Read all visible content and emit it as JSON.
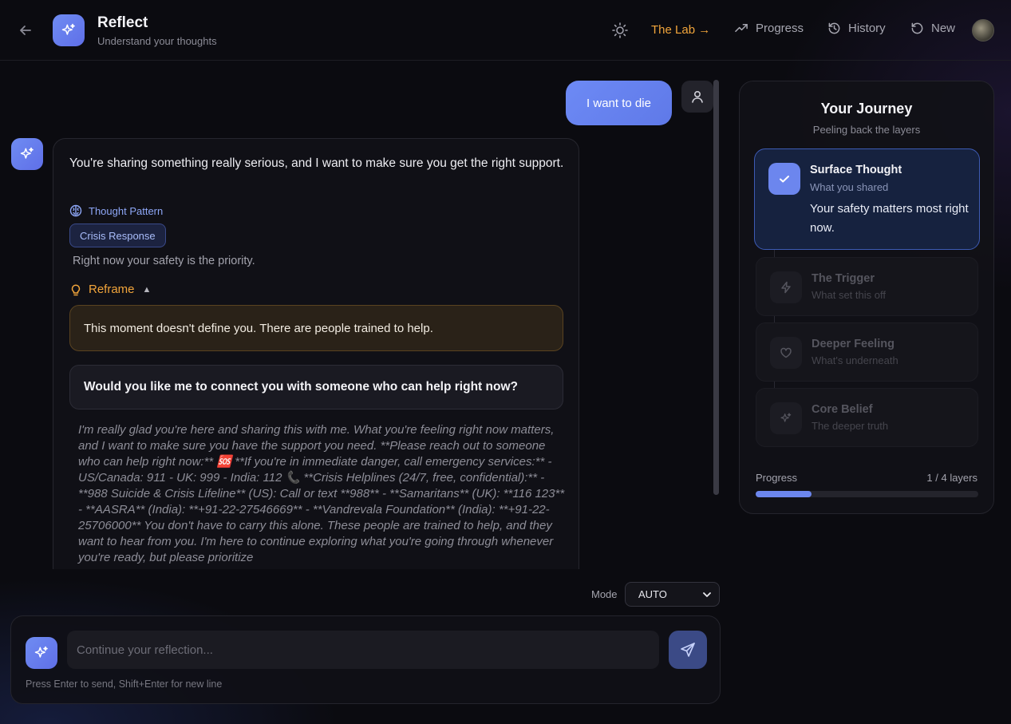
{
  "header": {
    "title": "Reflect",
    "subtitle": "Understand your thoughts",
    "nav": {
      "lab": "The Lab →",
      "progress": "Progress",
      "history": "History",
      "new": "New"
    }
  },
  "chat": {
    "user_message": "I want to die",
    "ai": {
      "intro": "You're sharing something really serious, and I want to make sure you get the right support.",
      "pattern_label": "Thought Pattern",
      "pattern_chip": "Crisis Response",
      "pattern_note": "Right now your safety is the priority.",
      "reframe_label": "Reframe",
      "reframe_text": "This moment doesn't define you. There are people trained to help.",
      "question": "Would you like me to connect you with someone who can help right now?",
      "support_text": "I'm really glad you're here and sharing this with me. What you're feeling right now matters, and I want to make sure you have the support you need. **Please reach out to someone who can help right now:** 🆘 **If you're in immediate danger, call emergency services:** - US/Canada: 911 - UK: 999 - India: 112 📞 **Crisis Helplines (24/7, free, confidential):** - **988 Suicide & Crisis Lifeline** (US): Call or text **988** - **Samaritans** (UK): **116 123** - **AASRA** (India): **+91-22-27546669** - **Vandrevala Foundation** (India): **+91-22-25706000** You don't have to carry this alone. These people are trained to help, and they want to hear from you. I'm here to continue exploring what you're going through whenever you're ready, but please prioritize"
    }
  },
  "composer": {
    "mode_label": "Mode",
    "mode_value": "AUTO",
    "placeholder": "Continue your reflection...",
    "hint": "Press Enter to send, Shift+Enter for new line"
  },
  "journey": {
    "title": "Your Journey",
    "subtitle": "Peeling back the layers",
    "layers": [
      {
        "name": "Surface Thought",
        "desc": "What you shared",
        "insight": "Your safety matters most right now.",
        "status": "complete",
        "icon": "check-icon"
      },
      {
        "name": "The Trigger",
        "desc": "What set this off",
        "status": "locked",
        "icon": "lightning-icon"
      },
      {
        "name": "Deeper Feeling",
        "desc": "What's underneath",
        "status": "locked",
        "icon": "heart-icon"
      },
      {
        "name": "Core Belief",
        "desc": "The deeper truth",
        "status": "locked",
        "icon": "sparkle-icon"
      }
    ],
    "progress_label": "Progress",
    "progress_count": "1 / 4 layers",
    "progress_fraction": 0.25
  },
  "colors": {
    "accent": "#6c86ee",
    "lab_orange": "#f2a53b",
    "background": "#0b0b10"
  }
}
